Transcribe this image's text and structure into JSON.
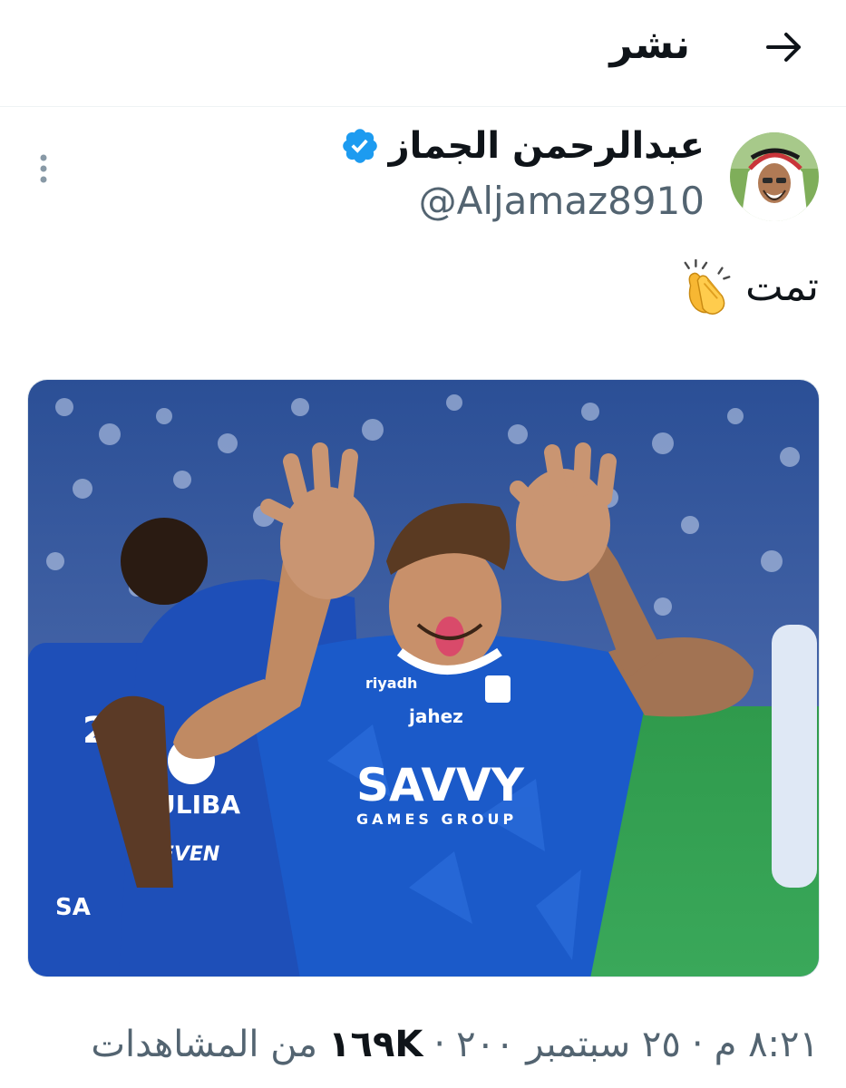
{
  "header": {
    "title": "نشر",
    "back_icon": "arrow-right-icon"
  },
  "tweet": {
    "author": {
      "display_name": "عبدالرحمن الجماز",
      "handle": "@Aljamaz8910",
      "verified": true,
      "verified_color": "#1d9bf0"
    },
    "text": "تمت",
    "emoji": "clapping-hands-icon",
    "media": {
      "jersey_text": [
        "SAVVY",
        "GAMES GROUP",
        "jahez",
        "riyadh",
        "ULIBA",
        "SEVEN"
      ]
    },
    "meta": {
      "time": "٨:٢١ م",
      "separator_1": "·",
      "date": "٢٥ سبتمبر ٢٠٠",
      "separator_2": "·",
      "views_count": "١٦٩K",
      "views_label": "من المشاهدات"
    }
  },
  "colors": {
    "accent": "#1d9bf0",
    "text": "#0f1419",
    "secondary": "#536471",
    "jersey_blue": "#1e4fb8"
  }
}
